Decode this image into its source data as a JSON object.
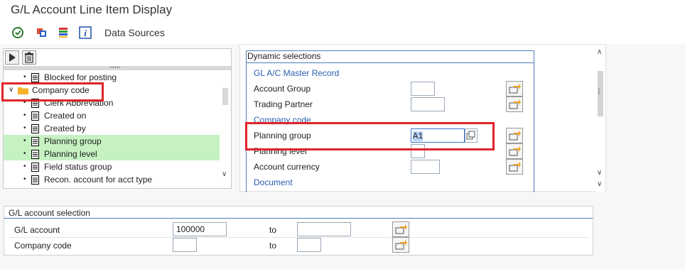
{
  "window": {
    "title": "G/L Account Line Item Display"
  },
  "toolbar": {
    "icons": [
      "execute-icon",
      "layout-icon",
      "list-icon",
      "info-icon"
    ],
    "data_sources_label": "Data Sources"
  },
  "tree": {
    "items": [
      {
        "label": "Blocked for posting",
        "type": "field",
        "selected": false
      },
      {
        "label": "Company code",
        "type": "folder",
        "selected": false
      },
      {
        "label": "Clerk Abbreviation",
        "type": "field",
        "selected": false
      },
      {
        "label": "Created on",
        "type": "field",
        "selected": false
      },
      {
        "label": "Created by",
        "type": "field",
        "selected": false
      },
      {
        "label": "Planning group",
        "type": "field",
        "selected": true
      },
      {
        "label": "Planning level",
        "type": "field",
        "selected": true
      },
      {
        "label": "Field status group",
        "type": "field",
        "selected": false
      },
      {
        "label": "Recon. account for acct type",
        "type": "field",
        "selected": false
      }
    ]
  },
  "dynamic": {
    "title": "Dynamic selections",
    "section_gl": "GL A/C Master Record",
    "account_group": {
      "label": "Account Group",
      "value": ""
    },
    "trading_partner": {
      "label": "Trading Partner",
      "value": ""
    },
    "section_cc": "Company code",
    "planning_group": {
      "label": "Planning group",
      "value": "A1"
    },
    "planning_level": {
      "label": "Planning level",
      "value": ""
    },
    "account_currency": {
      "label": "Account currency",
      "value": ""
    },
    "section_doc": "Document"
  },
  "glsel": {
    "title": "G/L account selection",
    "gl_account": {
      "label": "G/L account",
      "from": "100000",
      "to_label": "to",
      "to": ""
    },
    "company_code": {
      "label": "Company code",
      "from": "",
      "to_label": "to",
      "to": ""
    }
  },
  "colors": {
    "highlight_red": "#e0242a",
    "selected_green": "#c6f2c2",
    "link_blue": "#2a5eb0"
  }
}
